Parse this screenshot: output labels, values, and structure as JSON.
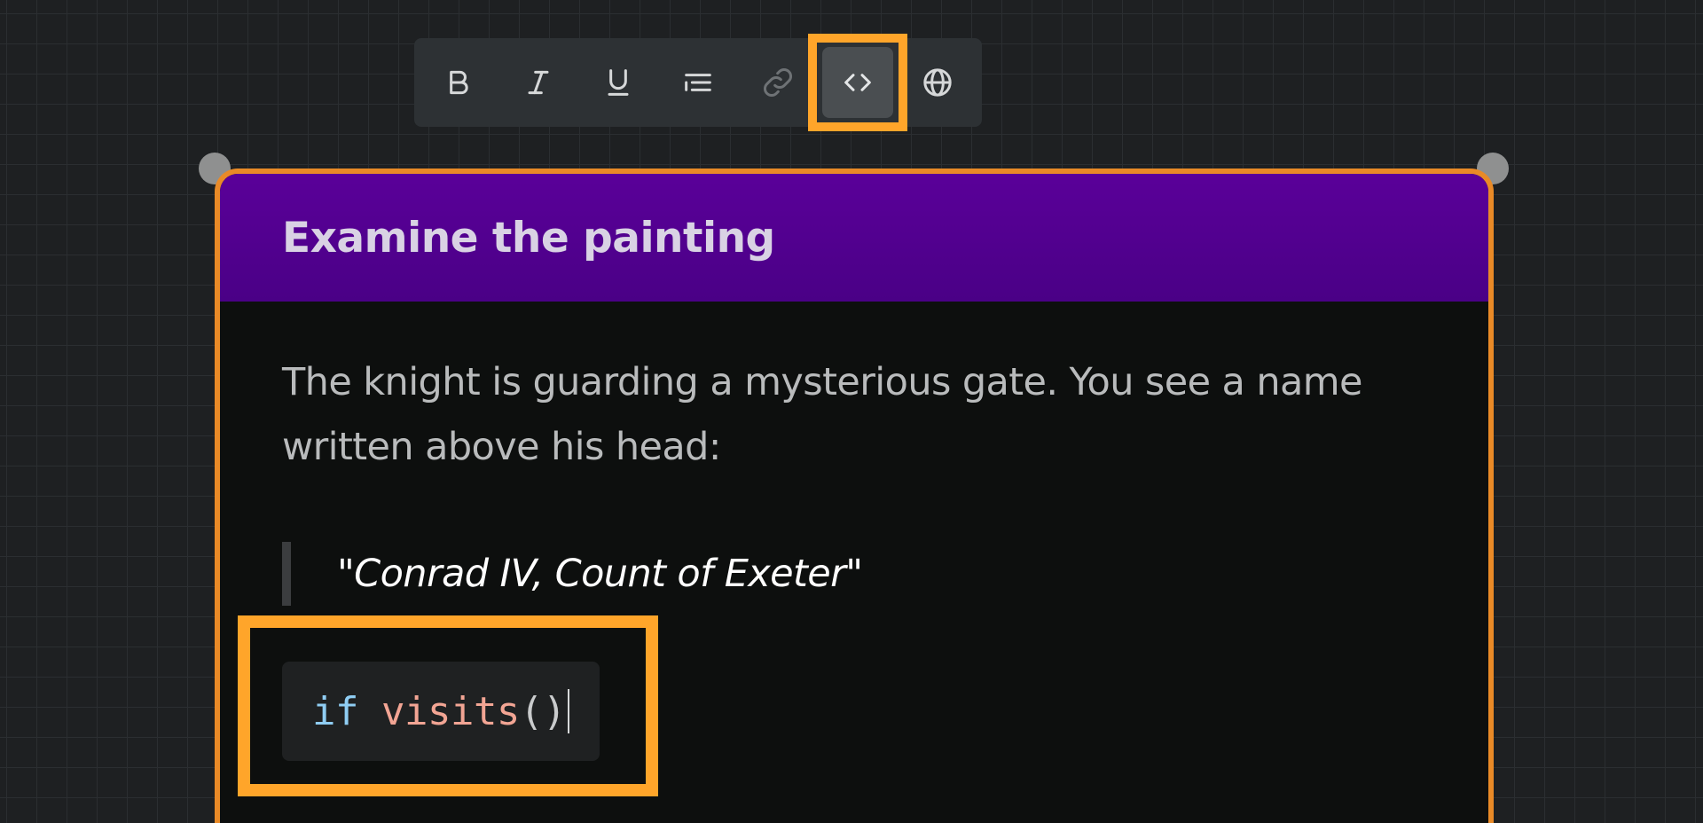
{
  "toolbar": {
    "buttons": [
      {
        "id": "bold",
        "icon": "bold-icon"
      },
      {
        "id": "italic",
        "icon": "italic-icon"
      },
      {
        "id": "underline",
        "icon": "underline-icon"
      },
      {
        "id": "list",
        "icon": "list-icon"
      },
      {
        "id": "link",
        "icon": "link-icon",
        "state": "disabled"
      },
      {
        "id": "code",
        "icon": "code-icon",
        "state": "active",
        "highlighted": true
      },
      {
        "id": "globe",
        "icon": "globe-icon"
      }
    ]
  },
  "node": {
    "title": "Examine the painting",
    "body_text": "The knight is guarding a mysterious gate. You see a name written above his head:",
    "quote": "\"Conrad IV, Count of Exeter\"",
    "code": {
      "keyword": "if ",
      "function": "visits",
      "parens": "()",
      "highlighted": true
    }
  },
  "colors": {
    "canvas_background": "#1e2022",
    "grid_line": "#2b2e31",
    "header_purple": "#5a0099",
    "node_border_orange": "#e98a27",
    "highlight_orange": "#ffa52a",
    "code_keyword": "#8fcdf3",
    "code_function": "#f2a594"
  }
}
